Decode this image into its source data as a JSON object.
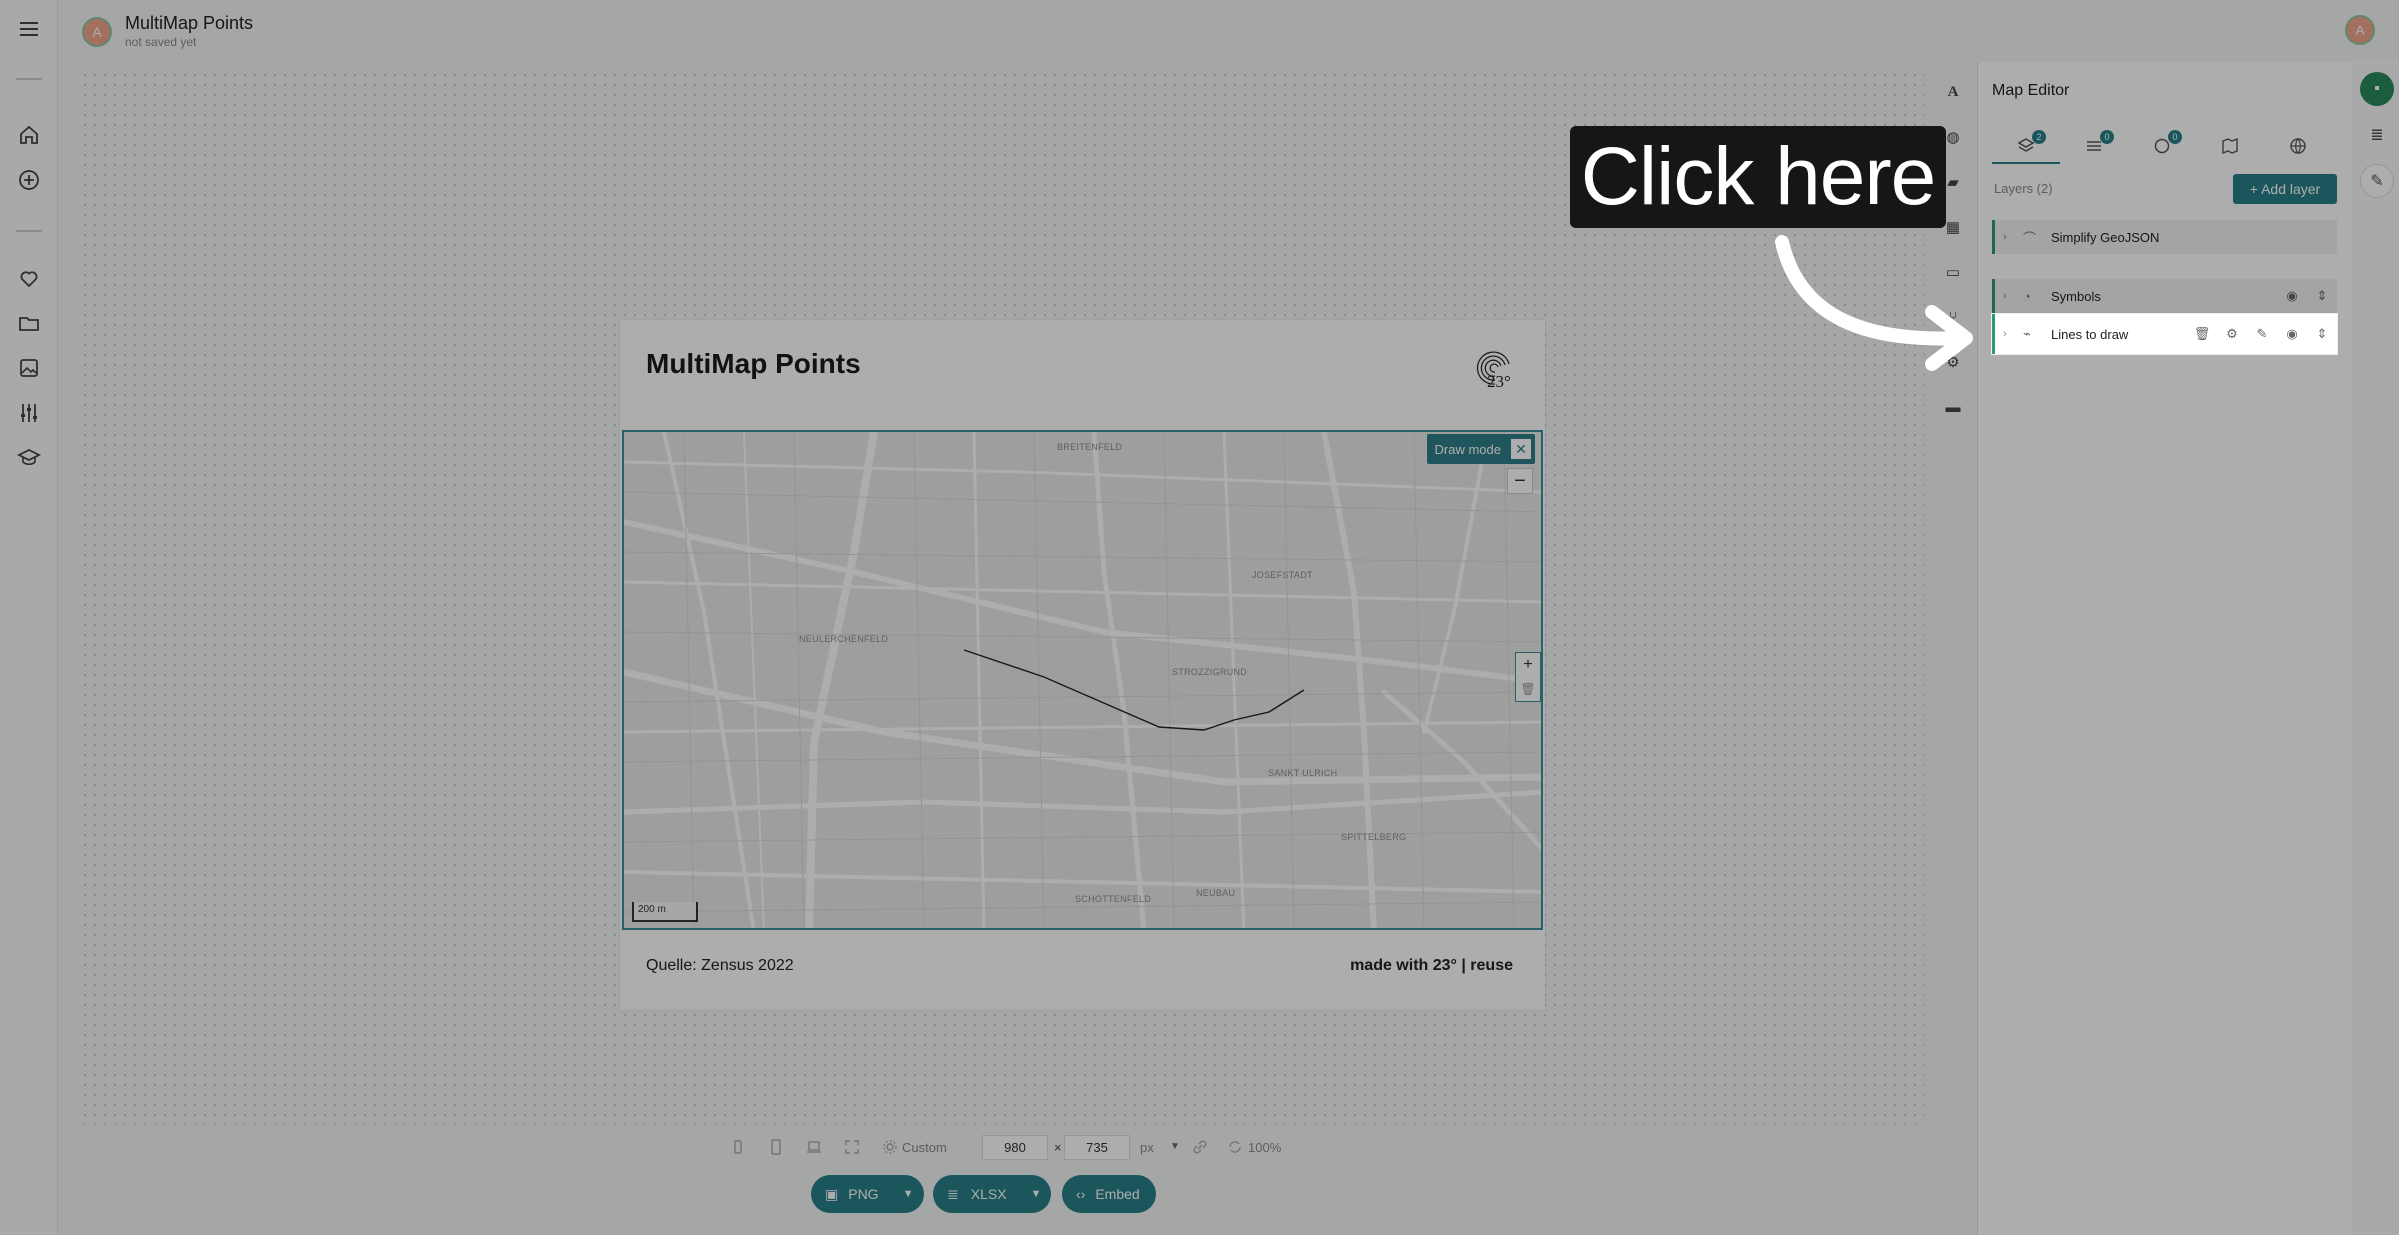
{
  "header": {
    "avatar_initial": "A",
    "title": "MultiMap Points",
    "subtitle": "not saved yet",
    "user_avatar_initial": "A"
  },
  "card": {
    "title": "MultiMap Points",
    "logo_text": "23°",
    "draw_mode_label": "Draw mode",
    "zoom_out": "−",
    "zoom_in": "+",
    "scale_label": "200 m",
    "map_labels": [
      "BREITENFELD",
      "JOSEFSTADT",
      "NEULERCHENFELD",
      "STROZZIGRUND",
      "SANKT ULRICH",
      "SPITTELBERG",
      "SCHOTTENFELD",
      "NEUBAU"
    ],
    "source": "Quelle: Zensus 2022",
    "made_with": "made with 23° | reuse"
  },
  "size_toolbar": {
    "preset": "Custom",
    "width": "980",
    "height": "735",
    "times": "×",
    "unit": "px",
    "zoom": "100%"
  },
  "export": {
    "png": "PNG",
    "xlsx": "XLSX",
    "embed": "Embed"
  },
  "panel": {
    "title": "Map Editor",
    "tabs": [
      {
        "icon": "layers-icon",
        "badge": "2"
      },
      {
        "icon": "filters-icon",
        "badge": "0"
      },
      {
        "icon": "palette-icon",
        "badge": "0"
      },
      {
        "icon": "basemap-icon",
        "badge": ""
      },
      {
        "icon": "globe-icon",
        "badge": ""
      }
    ],
    "layers_count": "Layers (2)",
    "add_layer": "+ Add layer",
    "layers": [
      {
        "name": "Simplify GeoJSON"
      },
      {
        "name": "Symbols"
      },
      {
        "name": "Lines to draw"
      }
    ]
  },
  "tutorial": {
    "callout": "Click here"
  },
  "colors": {
    "accent": "#2a7f89",
    "layer_accent": "#2a9a7a",
    "overlay": "rgba(0,0,0,0.32)"
  }
}
